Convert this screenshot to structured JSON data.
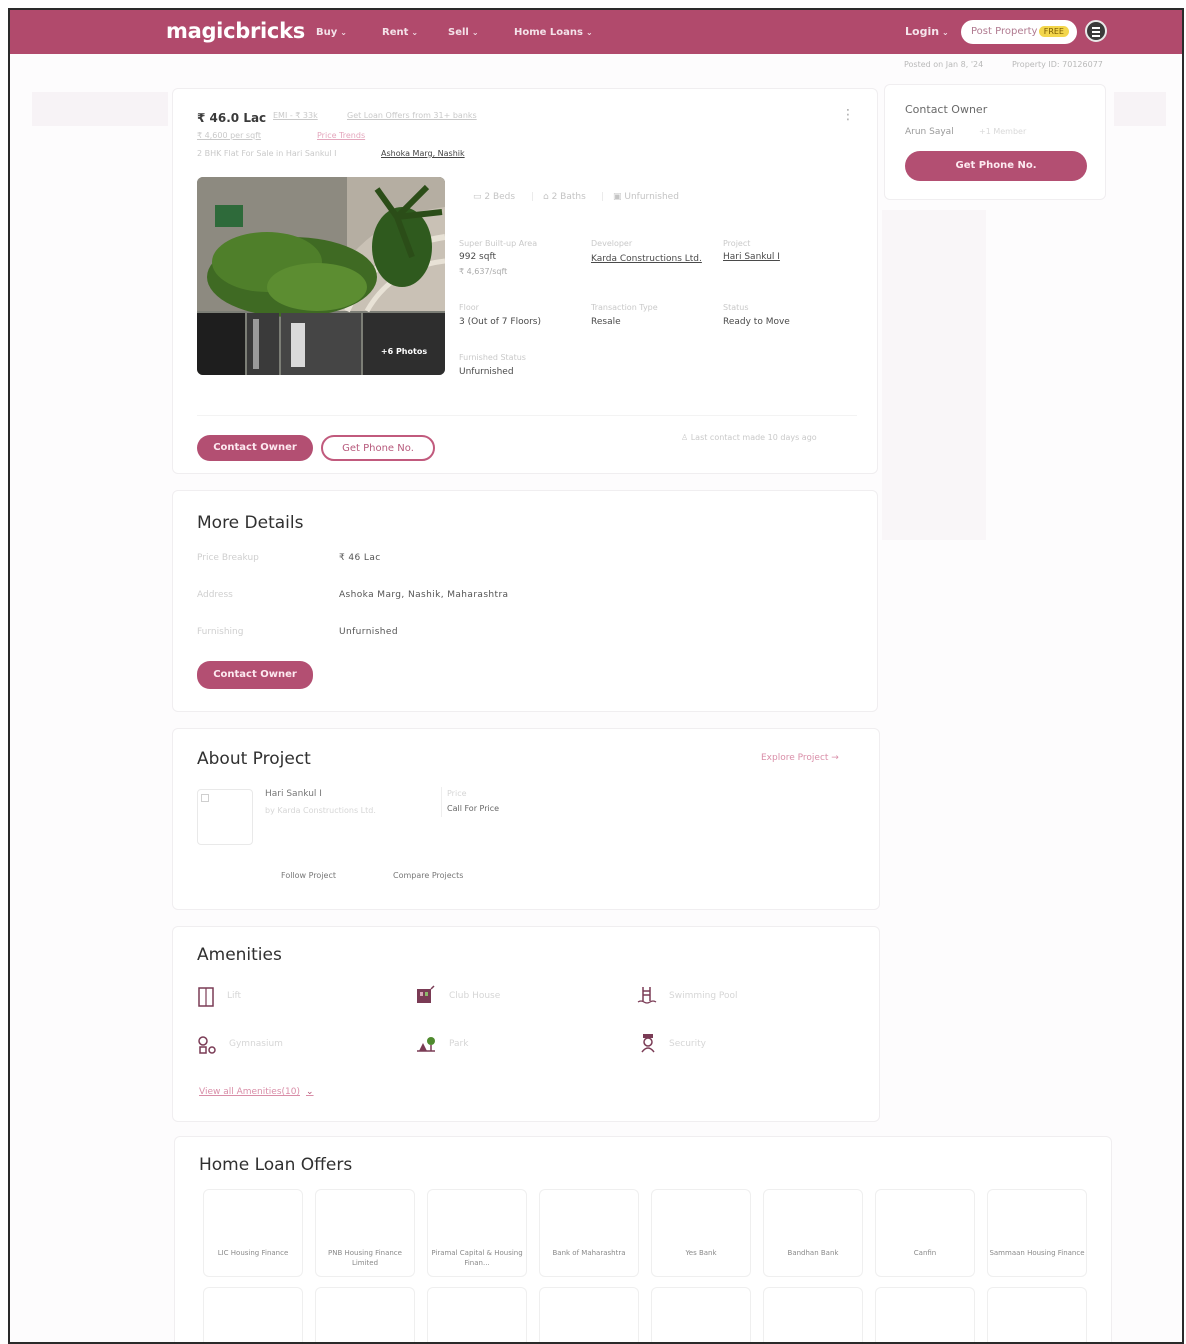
{
  "header": {
    "logo": "magicbricks",
    "nav": [
      {
        "label": "Buy"
      },
      {
        "label": "Rent"
      },
      {
        "label": "Sell"
      },
      {
        "label": "Home Loans"
      }
    ],
    "login_label": "Login",
    "post_property_label": "Post Property",
    "post_property_badge": "FREE",
    "caret": "⌄"
  },
  "subheader": {
    "posted": "Posted on Jan 8, '24",
    "property_id": "Property ID: 70126077"
  },
  "listing": {
    "price": "₹ 46.0 Lac",
    "emi": "EMI - ₹ 33k",
    "loan_offer": "Get Loan Offers from 31+ banks",
    "price_sqft": "₹ 4,600 per sqft",
    "price_trends": "Price Trends",
    "title": "2 BHK Flat For Sale in Hari Sankul I",
    "location": "Ashoka Marg, Nashik",
    "photos_count": "+6 Photos",
    "features": [
      "2 Beds",
      "2 Baths",
      "Unfurnished"
    ],
    "specs": [
      {
        "label": "Super Built-up Area",
        "value": "992 sqft",
        "sub": "₹ 4,637/sqft"
      },
      {
        "label": "Developer",
        "value": "Karda Constructions Ltd."
      },
      {
        "label": "Project",
        "value": "Hari Sankul I"
      },
      {
        "label": "Floor",
        "value": "3 (Out of 7 Floors)"
      },
      {
        "label": "Transaction Type",
        "value": "Resale"
      },
      {
        "label": "Status",
        "value": "Ready to Move"
      },
      {
        "label": "Furnished Status",
        "value": "Unfurnished"
      }
    ],
    "contact_owner": "Contact Owner",
    "get_phone": "Get Phone No.",
    "last_contact": "Last contact made 10 days ago"
  },
  "sidebar": {
    "title": "Contact Owner",
    "owner_name": "Arun Sayal",
    "owner_role": "+1 Member",
    "get_phone": "Get Phone No."
  },
  "more_details": {
    "title": "More Details",
    "rows": [
      {
        "label": "Price Breakup",
        "value": "₹ 46 Lac"
      },
      {
        "label": "Address",
        "value": "Ashoka Marg, Nashik, Maharashtra"
      },
      {
        "label": "Furnishing",
        "value": "Unfurnished"
      }
    ],
    "contact_owner": "Contact Owner"
  },
  "about_project": {
    "title": "About Project",
    "explore": "Explore Project →",
    "name": "Hari Sankul I",
    "developer": "by Karda Constructions Ltd.",
    "price_label": "Price",
    "price_value": "Call For Price",
    "follow": "Follow Project",
    "compare": "Compare Projects"
  },
  "amenities": {
    "title": "Amenities",
    "items": [
      {
        "label": "Lift",
        "icon": "lift-icon"
      },
      {
        "label": "Club House",
        "icon": "club-house-icon"
      },
      {
        "label": "Swimming Pool",
        "icon": "swimming-pool-icon"
      },
      {
        "label": "Gymnasium",
        "icon": "gymnasium-icon"
      },
      {
        "label": "Park",
        "icon": "park-icon"
      },
      {
        "label": "Security",
        "icon": "security-icon"
      }
    ],
    "view_all": "View all Amenities(10)"
  },
  "home_loans": {
    "title": "Home Loan Offers",
    "banks": [
      "LIC Housing Finance",
      "PNB Housing Finance Limited",
      "Piramal Capital & Housing Finan...",
      "Bank of Maharashtra",
      "Yes Bank",
      "Bandhan Bank",
      "Canfin",
      "Sammaan Housing Finance"
    ]
  },
  "colors": {
    "brand": "#b14a6c",
    "button": "#b34f72"
  }
}
